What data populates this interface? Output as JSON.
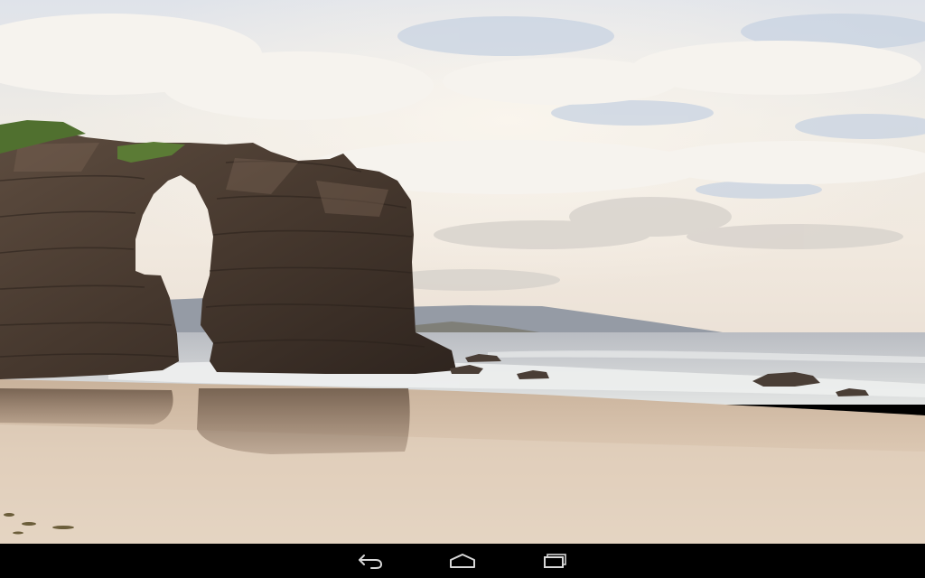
{
  "wallpaper": {
    "icon": "beach-arch-landscape",
    "colors": {
      "sky_top": "#d9dee6",
      "sky_mid": "#f0ebe2",
      "sky_horizon": "#efe6da",
      "sea": "#c9ccd0",
      "foam": "#e9ece9",
      "wet_sand": "#cdb7a0",
      "dry_sand": "#e3d2bf",
      "rock_dark": "#3b2f27",
      "rock_mid": "#5b4a3d",
      "grass": "#4d6b2e",
      "hills": "#8e96a0"
    }
  },
  "nav_bar": {
    "background": "#000000",
    "icon_color": "#d8d8d8",
    "buttons": [
      {
        "name": "back",
        "icon": "back-arrow-icon"
      },
      {
        "name": "home",
        "icon": "home-icon"
      },
      {
        "name": "recents",
        "icon": "recent-apps-icon"
      }
    ]
  }
}
